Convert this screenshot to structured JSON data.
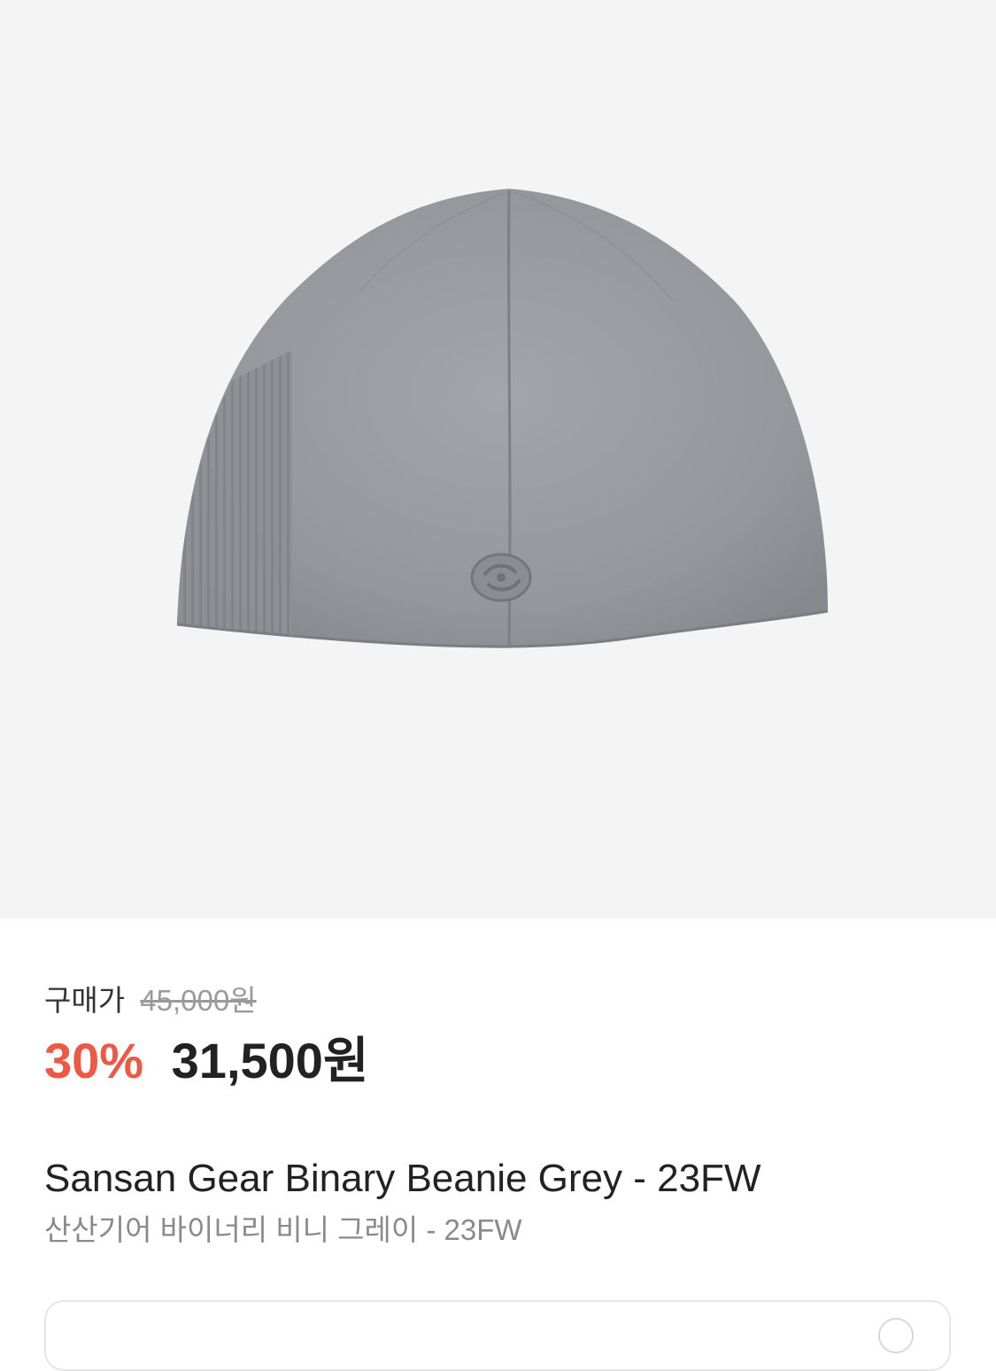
{
  "product": {
    "image_icon": "beanie-product-image",
    "price_label": "구매가",
    "original_price": "45,000원",
    "discount_rate": "30%",
    "sale_price": "31,500원",
    "name_en": "Sansan Gear Binary Beanie Grey - 23FW",
    "name_ko": "산산기어 바이너리 비니 그레이 - 23FW"
  },
  "colors": {
    "accent_discount": "#ef5844",
    "hero_background": "#f4f4f4",
    "product_grey": "#8e9196"
  }
}
